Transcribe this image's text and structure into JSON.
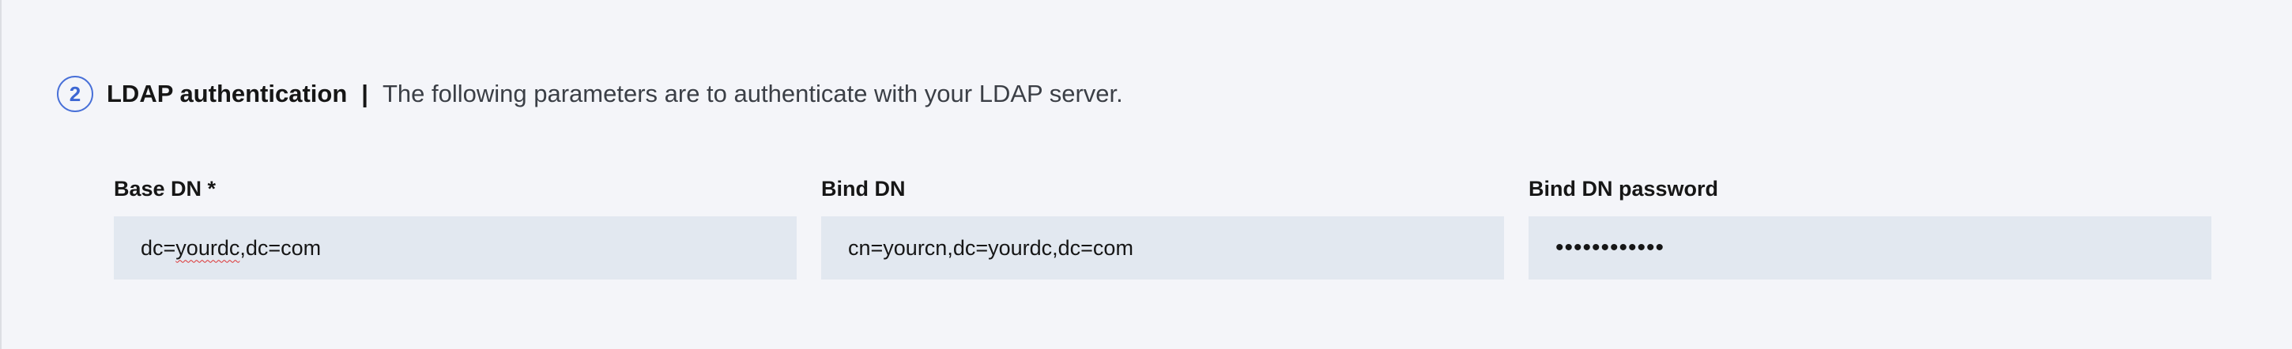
{
  "section": {
    "step_number": "2",
    "title": "LDAP authentication",
    "separator": "|",
    "description": "The following parameters are to authenticate with your LDAP server."
  },
  "fields": {
    "base_dn": {
      "label": "Base DN *",
      "value_prefix": "dc=",
      "value_flagged": "yourdc",
      "value_suffix": ",dc=com"
    },
    "bind_dn": {
      "label": "Bind DN",
      "value": "cn=yourcn,dc=yourdc,dc=com"
    },
    "bind_dn_password": {
      "label": "Bind DN password",
      "value": "••••••••••••"
    }
  },
  "colors": {
    "background": "#f4f5f9",
    "input_background": "#e2e8f0",
    "step_accent": "#3d67d3",
    "spellcheck_underline": "#dd3333"
  }
}
